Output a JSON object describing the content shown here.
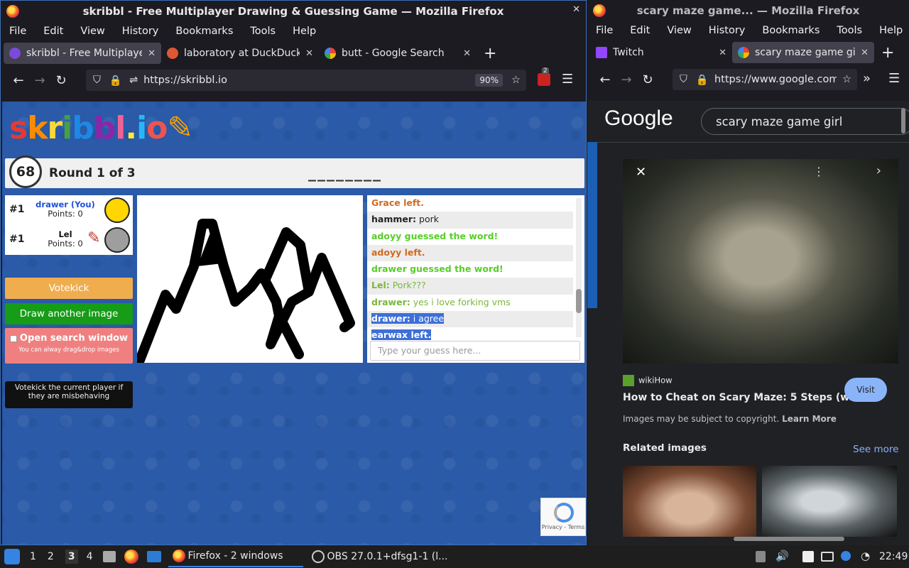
{
  "left_window": {
    "title": "skribbl - Free Multiplayer Drawing & Guessing Game — Mozilla Firefox",
    "menu": [
      "File",
      "Edit",
      "View",
      "History",
      "Bookmarks",
      "Tools",
      "Help"
    ],
    "tabs": [
      {
        "label": "skribbl - Free Multiplayer Drawing & Guessing Game",
        "active": true
      },
      {
        "label": "laboratory at DuckDuckGo",
        "active": false
      },
      {
        "label": "butt - Google Search",
        "active": false
      }
    ],
    "url": "https://skribbl.io",
    "zoom": "90%",
    "ext_badge": "2"
  },
  "skribbl": {
    "logo": "skribbl.io",
    "timer": "68",
    "round": "Round 1 of 3",
    "word_hint": "________",
    "players": [
      {
        "rank": "#1",
        "name": "drawer (You)",
        "points": "Points: 0",
        "name_color": "#1f4fd6"
      },
      {
        "rank": "#1",
        "name": "Lel",
        "points": "Points: 0",
        "name_color": "#111111"
      }
    ],
    "buttons": {
      "votekick": "Votekick",
      "draw_another": "Draw another image",
      "open_search": "Open search window",
      "open_search_sub": "You can alway drag&drop images"
    },
    "tooltip": "Votekick the current player if they are misbehaving",
    "chat": [
      {
        "who": "",
        "text": "Grace left.",
        "color": "#d2691e"
      },
      {
        "who": "hammer:",
        "text": " pork",
        "color": "#222222"
      },
      {
        "who": "",
        "text": "adoyy guessed the word!",
        "color": "#56ce27"
      },
      {
        "who": "",
        "text": "adoyy left.",
        "color": "#d2691e"
      },
      {
        "who": "",
        "text": "drawer guessed the word!",
        "color": "#56ce27"
      },
      {
        "who": "Lel:",
        "text": " Pork???",
        "color": "#7bb63b"
      },
      {
        "who": "drawer:",
        "text": " yes i love forking vms",
        "color": "#7bb63b"
      },
      {
        "who": "drawer:",
        "text": " i agree",
        "color": "#ffffff",
        "selected": true
      },
      {
        "who": "",
        "text": "earwax left.",
        "color": "#ffffff",
        "selected": true
      }
    ],
    "chat_placeholder": "Type your guess here...",
    "recaptcha": "Privacy - Terms"
  },
  "right_window": {
    "title": "scary maze game... — Mozilla Firefox",
    "menu": [
      "File",
      "Edit",
      "View",
      "History",
      "Bookmarks",
      "Tools",
      "Help"
    ],
    "tabs": [
      {
        "label": "Twitch",
        "active": false
      },
      {
        "label": "scary maze game girl",
        "active": true
      }
    ],
    "url": "https://www.google.com",
    "google": {
      "logo": "Google",
      "query": "scary maze game girl",
      "source": "wikiHow",
      "result_title": "How to Cheat on Scary Maze: 5 Steps (with...",
      "visit": "Visit",
      "copyright": "Images may be subject to copyright.",
      "learn_more": "Learn More",
      "related": "Related images",
      "see_more": "See more"
    }
  },
  "taskbar": {
    "workspaces": [
      "1",
      "2",
      "3",
      "4"
    ],
    "active_workspace": "3",
    "firefox_label": "Firefox - 2 windows",
    "obs_label": "OBS 27.0.1+dfsg1-1 (l...",
    "clock": "22:49"
  }
}
